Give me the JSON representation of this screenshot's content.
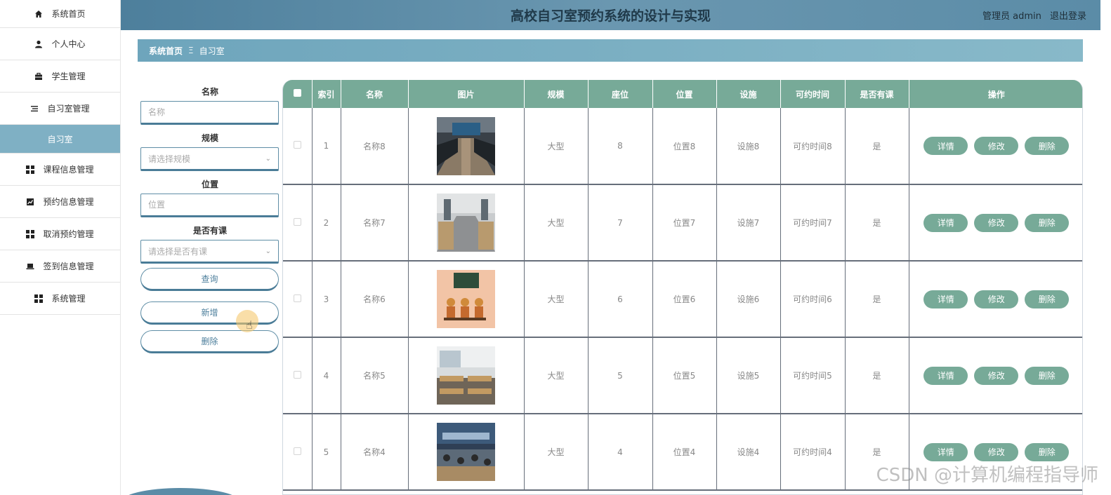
{
  "header": {
    "title": "高校自习室预约系统的设计与实现",
    "user_label": "管理员 admin",
    "logout_label": "退出登录"
  },
  "sidebar": {
    "items": [
      {
        "label": "系统首页",
        "icon": "home-icon"
      },
      {
        "label": "个人中心",
        "icon": "user-icon"
      },
      {
        "label": "学生管理",
        "icon": "briefcase-icon"
      },
      {
        "label": "自习室管理",
        "icon": "list-icon"
      },
      {
        "label": "自习室",
        "icon": ""
      },
      {
        "label": "课程信息管理",
        "icon": "grid-icon"
      },
      {
        "label": "预约信息管理",
        "icon": "chart-icon"
      },
      {
        "label": "取消预约管理",
        "icon": "grid-icon"
      },
      {
        "label": "签到信息管理",
        "icon": "laptop-icon"
      },
      {
        "label": "系统管理",
        "icon": "grid-icon"
      }
    ]
  },
  "breadcrumb": {
    "home": "系统首页",
    "separator": "Ξ",
    "current": "自习室"
  },
  "search": {
    "name_label": "名称",
    "name_placeholder": "名称",
    "scale_label": "规模",
    "scale_placeholder": "请选择规模",
    "location_label": "位置",
    "location_placeholder": "位置",
    "has_class_label": "是否有课",
    "has_class_placeholder": "请选择是否有课",
    "query_button": "查询",
    "add_button": "新增",
    "delete_button": "删除"
  },
  "table": {
    "headers": [
      "索引",
      "名称",
      "图片",
      "规模",
      "座位",
      "位置",
      "设施",
      "可约时间",
      "是否有课",
      "操作"
    ],
    "rows": [
      {
        "index": "1",
        "name": "名称8",
        "scale": "大型",
        "seats": "8",
        "location": "位置8",
        "facility": "设施8",
        "time": "可约时间8",
        "has_class": "是"
      },
      {
        "index": "2",
        "name": "名称7",
        "scale": "大型",
        "seats": "7",
        "location": "位置7",
        "facility": "设施7",
        "time": "可约时间7",
        "has_class": "是"
      },
      {
        "index": "3",
        "name": "名称6",
        "scale": "大型",
        "seats": "6",
        "location": "位置6",
        "facility": "设施6",
        "time": "可约时间6",
        "has_class": "是"
      },
      {
        "index": "4",
        "name": "名称5",
        "scale": "大型",
        "seats": "5",
        "location": "位置5",
        "facility": "设施5",
        "time": "可约时间5",
        "has_class": "是"
      },
      {
        "index": "5",
        "name": "名称4",
        "scale": "大型",
        "seats": "4",
        "location": "位置4",
        "facility": "设施4",
        "time": "可约时间4",
        "has_class": "是"
      }
    ],
    "actions": {
      "detail": "详情",
      "edit": "修改",
      "delete": "删除"
    },
    "thumbnails": [
      "study-room-photo",
      "study-room-photo",
      "study-room-poster",
      "study-room-photo",
      "study-room-photo"
    ]
  },
  "watermark": "CSDN @计算机编程指导师",
  "colors": {
    "header": "#5b8ca7",
    "accent": "#77aa98",
    "breadcrumb": "#7fb0c4"
  }
}
